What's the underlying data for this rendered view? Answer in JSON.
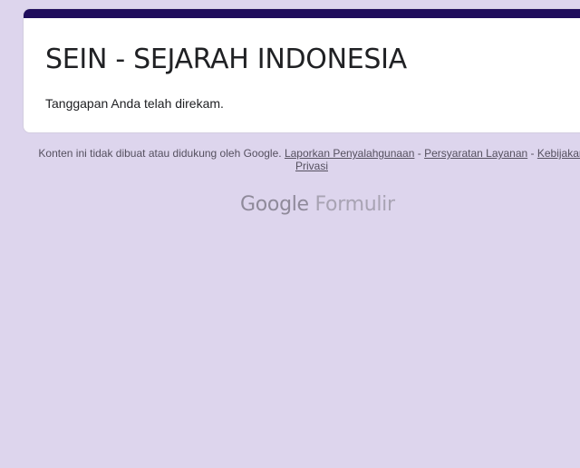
{
  "form": {
    "title": "SEIN - SEJARAH INDONESIA",
    "confirmation_message": "Tanggapan Anda telah direkam."
  },
  "footer": {
    "disclaimer": "Konten ini tidak dibuat atau didukung oleh Google.",
    "links": {
      "report_abuse": "Laporkan Penyalahgunaan",
      "terms_of_service": "Persyaratan Layanan",
      "privacy_policy": "Kebijakan Privasi"
    },
    "separator": "-"
  },
  "branding": {
    "google": "Google",
    "product": "Formulir"
  },
  "colors": {
    "page_background": "#ddd5ed",
    "card_accent": "#1f0d5c",
    "card_background": "#ffffff"
  }
}
